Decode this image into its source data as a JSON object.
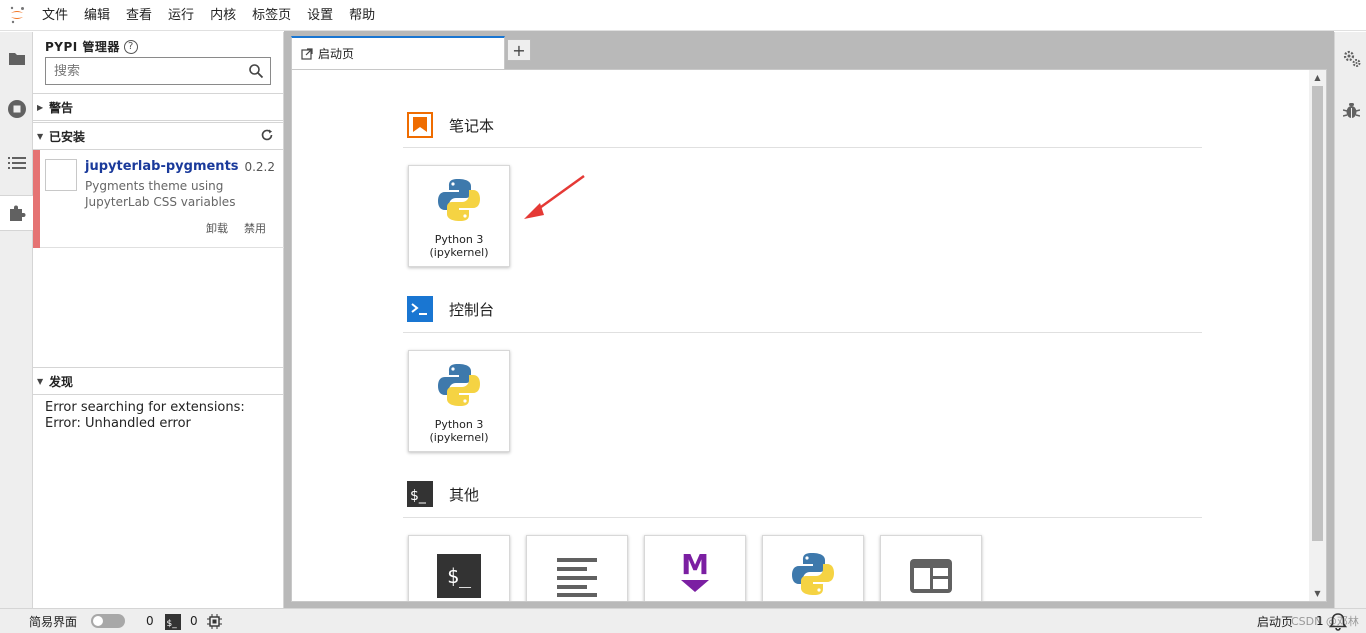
{
  "menubar": {
    "items": [
      "文件",
      "编辑",
      "查看",
      "运行",
      "内核",
      "标签页",
      "设置",
      "帮助"
    ]
  },
  "activity": {
    "icons": [
      "folder-icon",
      "running-icon",
      "toc-icon",
      "extension-icon"
    ]
  },
  "extension_manager": {
    "title": "PYPI 管理器",
    "help": "?",
    "search_placeholder": "搜索",
    "warnings_label": "警告",
    "installed_label": "已安装",
    "discover_label": "发现",
    "installed": [
      {
        "name": "jupyterlab-pygments",
        "version": "0.2.2",
        "description": "Pygments theme using JupyterLab CSS variables",
        "uninstall_label": "卸载",
        "disable_label": "禁用"
      }
    ],
    "discover_message": "Error searching for extensions: Error: Unhandled error"
  },
  "tabs": [
    {
      "label": "启动页"
    }
  ],
  "tab_add": "+",
  "launcher": {
    "notebook_section": "笔记本",
    "console_section": "控制台",
    "other_section": "其他",
    "notebook_cards": [
      {
        "line1": "Python 3",
        "line2": "(ipykernel)"
      }
    ],
    "console_cards": [
      {
        "line1": "Python 3",
        "line2": "(ipykernel)"
      }
    ],
    "other_cards": [
      "terminal-icon",
      "text-file-icon",
      "markdown-file-icon",
      "python-file-icon",
      "contextual-help-icon"
    ],
    "other_glyphs": {
      "terminal": "$_",
      "markdown": "M"
    }
  },
  "statusbar": {
    "simple_label": "简易界面",
    "terminals_count": "0",
    "kernels_count": "0",
    "right_label": "启动页",
    "right_count": "1",
    "watermark": "CSDN @邓林"
  },
  "colors": {
    "accent_blue": "#1976d2",
    "notebook_orange": "#ef6c00",
    "installed_red": "#e57373",
    "extension_name": "#1a3a9b",
    "markdown_purple": "#7b1fa2"
  }
}
